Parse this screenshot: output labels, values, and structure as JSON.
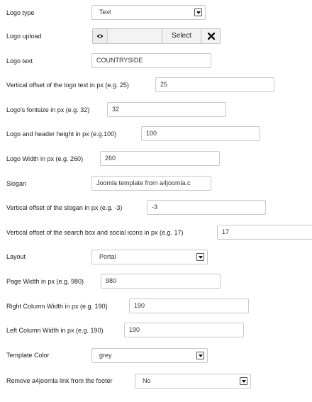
{
  "fields": {
    "logo_type": {
      "label": "Logo type",
      "value": "Text"
    },
    "logo_upload": {
      "label": "Logo upload",
      "select_label": "Select"
    },
    "logo_text": {
      "label": "Logo text",
      "value": "COUNTRYSIDE"
    },
    "logo_offset": {
      "label": "Vertical offset of the logo text in px (e.g. 25)",
      "value": "25"
    },
    "logo_fontsize": {
      "label": "Logo's fontsize in px (e.g. 32)",
      "value": "32"
    },
    "header_height": {
      "label": "Logo and header height in px (e.g.100)",
      "value": "100"
    },
    "logo_width": {
      "label": "Logo Width in px (e.g. 260)",
      "value": "260"
    },
    "slogan": {
      "label": "Slogan",
      "value": "Joomla template from a4joomla.c"
    },
    "slogan_offset": {
      "label": "Vertical offset of the slogan in px (e.g. -3)",
      "value": "-3"
    },
    "search_offset": {
      "label": "Vertical offset of the search box and social icons in px (e.g. 17)",
      "value": "17"
    },
    "layout": {
      "label": "Layout",
      "value": "Portal"
    },
    "page_width": {
      "label": "Page Width in px (e.g. 980)",
      "value": "980"
    },
    "right_col_width": {
      "label": "Right Column Width in px (e.g. 190)",
      "value": "190"
    },
    "left_col_width": {
      "label": "Left Column Width in px (e.g. 190)",
      "value": "190"
    },
    "template_color": {
      "label": "Template Color",
      "value": "grey"
    },
    "remove_link": {
      "label": "Remove a4joomla link from the footer",
      "value": "No"
    }
  },
  "icons": {
    "preview": "eye-icon",
    "clear": "close-icon",
    "dropdown": "chevron-down-icon"
  }
}
